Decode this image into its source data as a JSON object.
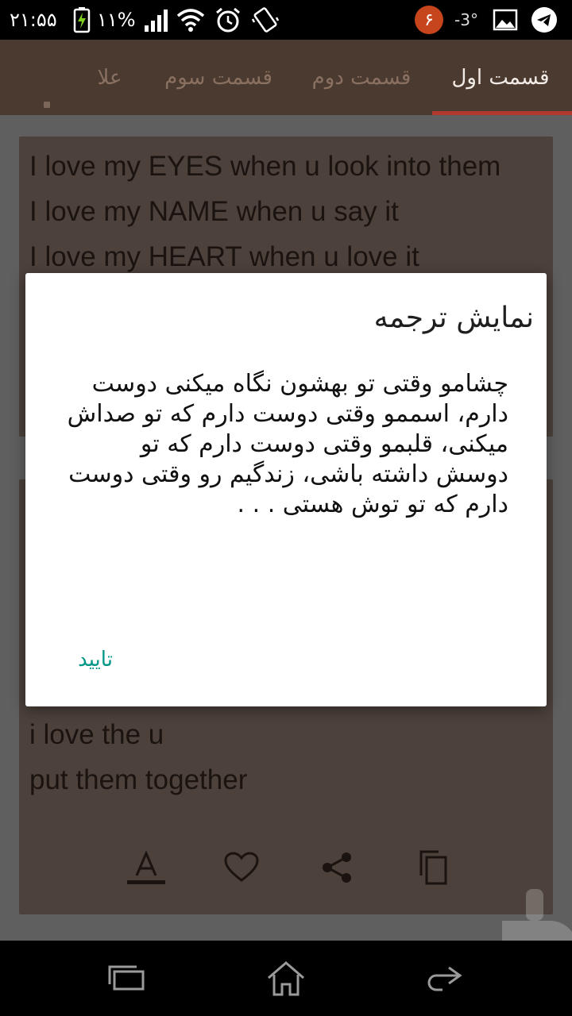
{
  "status_bar": {
    "time": "۲۱:۵۵",
    "battery": "۱۱%",
    "temperature": "-3°",
    "notification_badge": "۶",
    "icons": [
      "battery-charging-icon",
      "signal-icon",
      "wifi-icon",
      "alarm-icon",
      "vibrate-icon",
      "image-icon",
      "telegram-icon"
    ]
  },
  "tabs": [
    {
      "label": "قسمت اول",
      "active": true
    },
    {
      "label": "قسمت دوم",
      "active": false
    },
    {
      "label": "قسمت سوم",
      "active": false
    },
    {
      "label": "علا",
      "active": false
    }
  ],
  "card_top": {
    "lines": [
      "I love my EYES when u look into them",
      "I love my NAME when u say it",
      "I love my HEART when u love it"
    ]
  },
  "card_bottom": {
    "lines": [
      "i love the u",
      "put them together"
    ],
    "actions": [
      "font-size-icon",
      "heart-icon",
      "share-icon",
      "copy-icon"
    ]
  },
  "dialog": {
    "title": "نمایش ترجمه",
    "message": "چشامو وقتی تو بهشون نگاه میکنی دوست دارم، اسممو وقتی دوست دارم که تو صداش میکنی، قلبمو وقتی دوست دارم که تو دوسش داشته باشی، زندگیم رو وقتی دوست دارم که تو توش هستی . . .",
    "confirm_label": "تایید"
  },
  "colors": {
    "accent": "#009688",
    "tab_indicator": "#b03a2e",
    "toolbar": "#4a3a30",
    "card": "#4c413b"
  },
  "nav_icons": [
    "recent-apps-icon",
    "home-icon",
    "back-icon"
  ]
}
